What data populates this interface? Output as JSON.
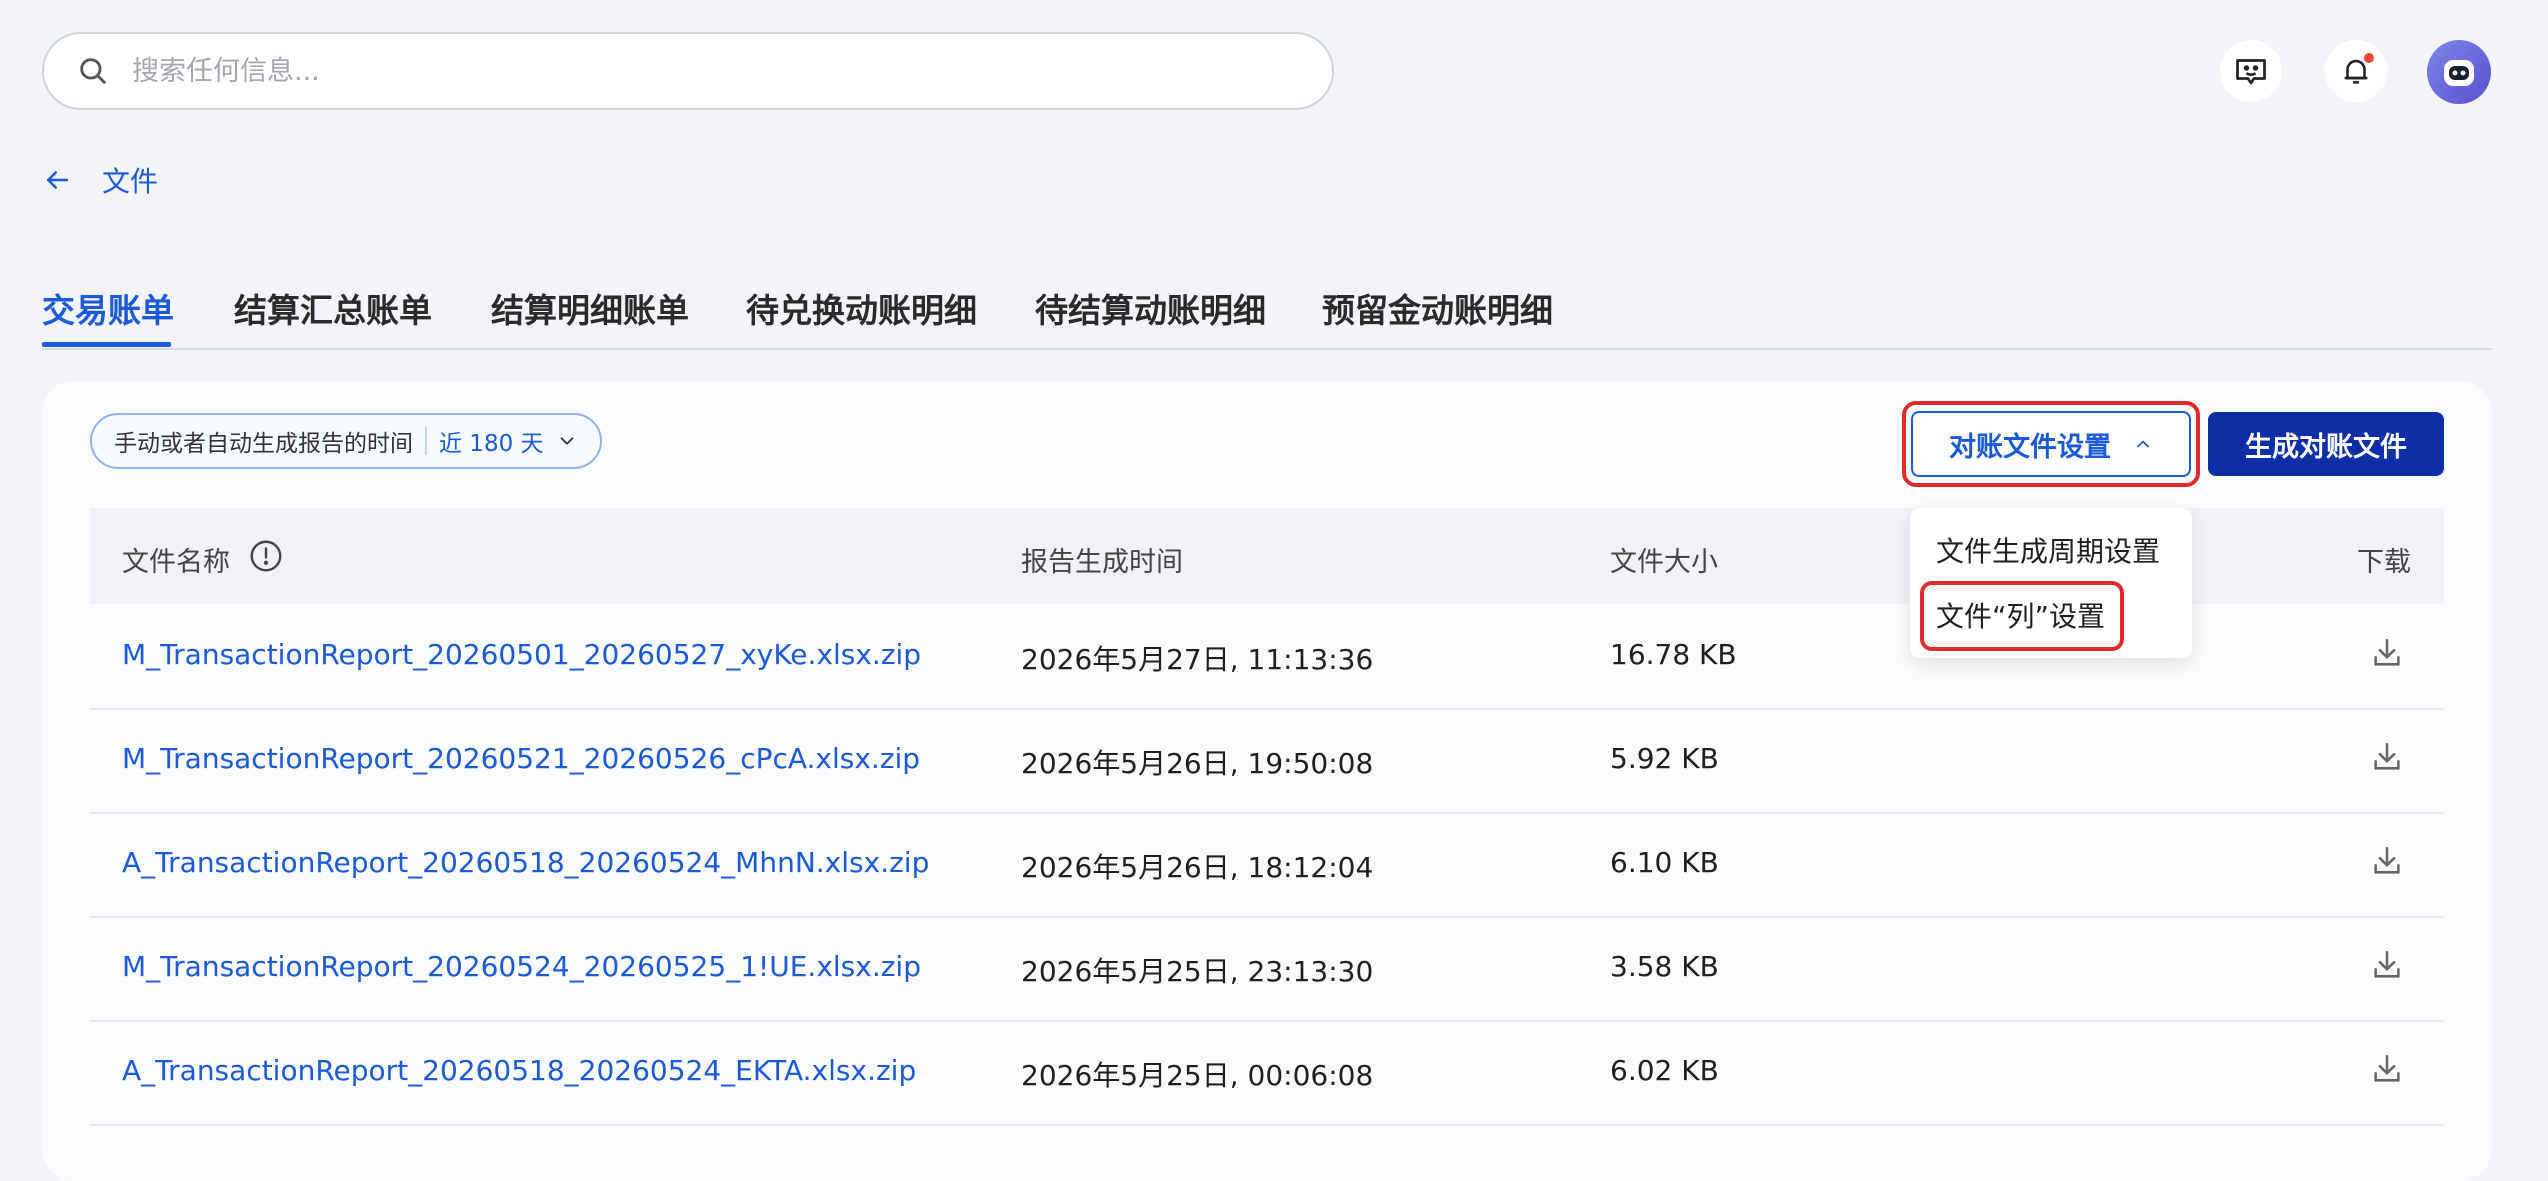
{
  "search": {
    "placeholder": "搜索任何信息..."
  },
  "header": {
    "icons": [
      "feedback-icon",
      "bell-icon",
      "avatar"
    ],
    "notification_color": "#f0433a"
  },
  "breadcrumb": {
    "back_label": "文件"
  },
  "tabs": [
    {
      "label": "交易账单",
      "active": true
    },
    {
      "label": "结算汇总账单",
      "active": false
    },
    {
      "label": "结算明细账单",
      "active": false
    },
    {
      "label": "待兑换动账明细",
      "active": false
    },
    {
      "label": "待结算动账明细",
      "active": false
    },
    {
      "label": "预留金动账明细",
      "active": false
    }
  ],
  "filter": {
    "label": "手动或者自动生成报告的时间",
    "value": "近 180 天"
  },
  "actions": {
    "settings_label": "对账文件设置",
    "generate_label": "生成对账文件"
  },
  "dropdown": {
    "items": [
      "文件生成周期设置",
      "文件“列”设置"
    ],
    "highlighted_index": 1
  },
  "table": {
    "columns": {
      "name": "文件名称",
      "time": "报告生成时间",
      "size": "文件大小",
      "download": "下载"
    },
    "rows": [
      {
        "name": "M_TransactionReport_20260501_20260527_xyKe.xlsx.zip",
        "time": "2026年5月27日, 11:13:36",
        "size": "16.78 KB"
      },
      {
        "name": "M_TransactionReport_20260521_20260526_cPcA.xlsx.zip",
        "time": "2026年5月26日, 19:50:08",
        "size": "5.92 KB"
      },
      {
        "name": "A_TransactionReport_20260518_20260524_MhnN.xlsx.zip",
        "time": "2026年5月26日, 18:12:04",
        "size": "6.10 KB"
      },
      {
        "name": "M_TransactionReport_20260524_20260525_1!UE.xlsx.zip",
        "time": "2026年5月25日, 23:13:30",
        "size": "3.58 KB"
      },
      {
        "name": "A_TransactionReport_20260518_20260524_EKTA.xlsx.zip",
        "time": "2026年5月25日, 00:06:08",
        "size": "6.02 KB"
      }
    ]
  },
  "colors": {
    "accent": "#1a5ad7",
    "primary_button": "#0c2fa8",
    "highlight": "#e22a2a"
  }
}
